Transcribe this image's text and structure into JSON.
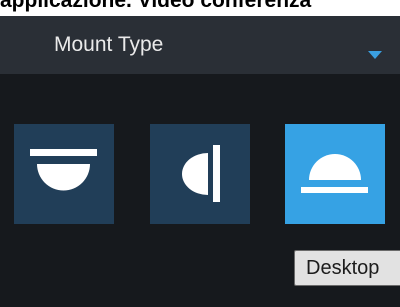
{
  "caption": "applicazione. Video conferenza",
  "mount_type": {
    "label": "Mount Type",
    "options": [
      {
        "name": "Ceiling",
        "icon": "ceiling-mount-icon",
        "selected": false
      },
      {
        "name": "Wall",
        "icon": "wall-mount-icon",
        "selected": false
      },
      {
        "name": "Desktop",
        "icon": "desktop-mount-icon",
        "selected": true
      }
    ]
  },
  "tooltip": "Desktop",
  "colors": {
    "panel_bg": "#16191d",
    "dropdown_bg": "#2a2f36",
    "button_bg": "#213e58",
    "selected_bg": "#36a2e4",
    "caret": "#3a9fe0"
  }
}
